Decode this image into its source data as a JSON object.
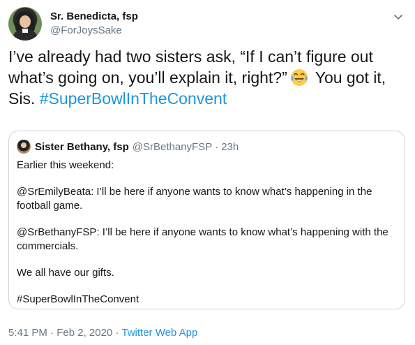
{
  "author": {
    "display_name": "Sr. Benedicta, fsp",
    "handle": "@ForJoysSake"
  },
  "tweet": {
    "text_1": "I’ve already had two sisters ask, “If I can’t figure out what’s going on, you’ll explain it, right?”",
    "text_2": " You got it, Sis.",
    "hashtag": "#SuperBowlInTheConvent",
    "emoji": "face-with-tears-of-joy"
  },
  "quoted": {
    "display_name": "Sister Bethany, fsp",
    "handle": "@SrBethanyFSP",
    "separator": "·",
    "time": "23h",
    "paragraphs": [
      "Earlier this weekend:",
      "@SrEmilyBeata: I’ll be here if anyone wants to know what’s happening in the football game.",
      "@SrBethanyFSP: I’ll be here if anyone wants to know what’s happening with the commercials.",
      "We all have our gifts.",
      "#SuperBowlInTheConvent"
    ]
  },
  "meta": {
    "time": "5:41 PM",
    "separator": "·",
    "date": "Feb 2, 2020",
    "app": "Twitter Web App"
  },
  "colors": {
    "link": "#1b95e0",
    "secondary": "#657786",
    "border": "#ccd6dd"
  }
}
